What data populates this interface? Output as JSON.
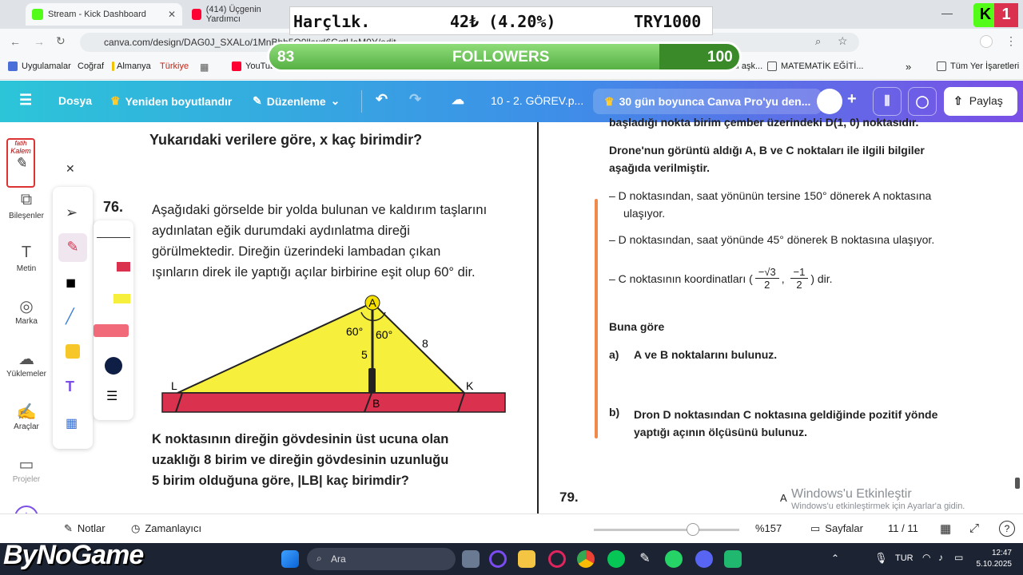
{
  "browser": {
    "tabs": [
      {
        "label": "Stream - Kick Dashboard",
        "color": "#53fc18"
      },
      {
        "label": "(414) Üçgenin Yardımcı",
        "color": "#ff0033"
      }
    ],
    "url": "canva.com/design/DAG0J_SXALo/1MnBbb5Q0lkwd6CqtUaM0Y/edit",
    "bookmarks": [
      {
        "label": "Uygulamalar"
      },
      {
        "label": "Coğraf"
      },
      {
        "label": "Almanya"
      },
      {
        "label": "Türkiye"
      },
      {
        "label": "YouTube"
      },
      {
        "label": "Divan edebiyatı aşk..."
      },
      {
        "label": "MATEMATİK EĞİTİ..."
      },
      {
        "label": "Tüm Yer İşaretleri"
      }
    ]
  },
  "overlay": {
    "harclik_label": "Harçlık.",
    "harclik_value": "42₺ (4.20%)",
    "harclik_goal": "TRY1000",
    "followers_current": "83",
    "followers_label": "FOLLOWERS",
    "followers_goal": "100",
    "followers_progress": 0.83,
    "kick_count": "1",
    "brand": "ByNoGame"
  },
  "canva": {
    "menu": "Dosya",
    "resize": "Yeniden boyutlandır",
    "edit": "Düzenleme",
    "doc_title": "10 - 2. GÖREV.p...",
    "promo": "30 gün boyunca Canva Pro'yu den...",
    "share": "Paylaş"
  },
  "rail": {
    "logo_top": "fatih",
    "logo_bottom": "Kalem",
    "items": [
      "Bileşenler",
      "Metin",
      "Marka",
      "Yüklemeler",
      "Araçlar",
      "Projeler"
    ]
  },
  "left_page": {
    "prev_question": "Yukarıdaki verilere göre, x kaç birimdir?",
    "q_number": "76.",
    "q_text_lines": [
      "Aşağıdaki görselde bir yolda bulunan ve kaldırım taşlarını",
      "aydınlatan eğik durumdaki aydınlatma direği",
      "görülmektedir. Direğin üzerindeki lambadan çıkan",
      "ışınların direk ile yaptığı açılar birbirine eşit olup 60° dir."
    ],
    "fig": {
      "A": "A",
      "B": "B",
      "K": "K",
      "L": "L",
      "angle1": "60°",
      "angle2": "60°",
      "len5": "5",
      "len8": "8"
    },
    "q_bottom_lines": [
      "K noktasının direğin gövdesinin üst ucuna olan",
      "uzaklığı 8 birim ve direğin gövdesinin uzunluğu",
      "5 birim olduğuna göre, |LB| kaç birimdir?"
    ]
  },
  "right_page": {
    "cut_line": "başladığı nokta birim çember üzerindeki D(1, 0) noktasıdır.",
    "intro_lines": [
      "Drone'nun görüntü aldığı A, B ve C noktaları ile ilgili bilgiler",
      "aşağıda verilmiştir."
    ],
    "bullet1_lines": [
      "– D noktasından, saat yönünün tersine 150° dönerek A noktasına",
      "ulaşıyor."
    ],
    "bullet2": "– D noktasından, saat yönünde 45° dönerek B noktasına ulaşıyor.",
    "bullet3_pre": "– C noktasının koordinatları (",
    "frac1_num": "−√3",
    "frac1_den": "2",
    "frac2_num": "−1",
    "frac2_den": "2",
    "bullet3_post": ") dir.",
    "buna_gore": "Buna göre",
    "a_label": "a)",
    "a_text": "A ve B noktalarını bulunuz.",
    "b_label": "b)",
    "b_text_lines": [
      "Dron D noktasından C noktasına geldiğinde pozitif yönde",
      "yaptığı açının ölçüsünü bulunuz."
    ],
    "next_number": "79."
  },
  "bottom_bar": {
    "notes": "Notlar",
    "timer": "Zamanlayıcı",
    "zoom": "%157",
    "zoom_level": 0.68,
    "pages": "Sayfalar",
    "page_count": "11 / 11",
    "help": "?"
  },
  "watermark": {
    "title": "Windows'u Etkinleştir",
    "sub": "Windows'u etkinleştirmek için Ayarlar'a gidin."
  },
  "taskbar": {
    "search": "Ara",
    "lang": "TUR",
    "time": "12:47",
    "date": "5.10.2025"
  }
}
